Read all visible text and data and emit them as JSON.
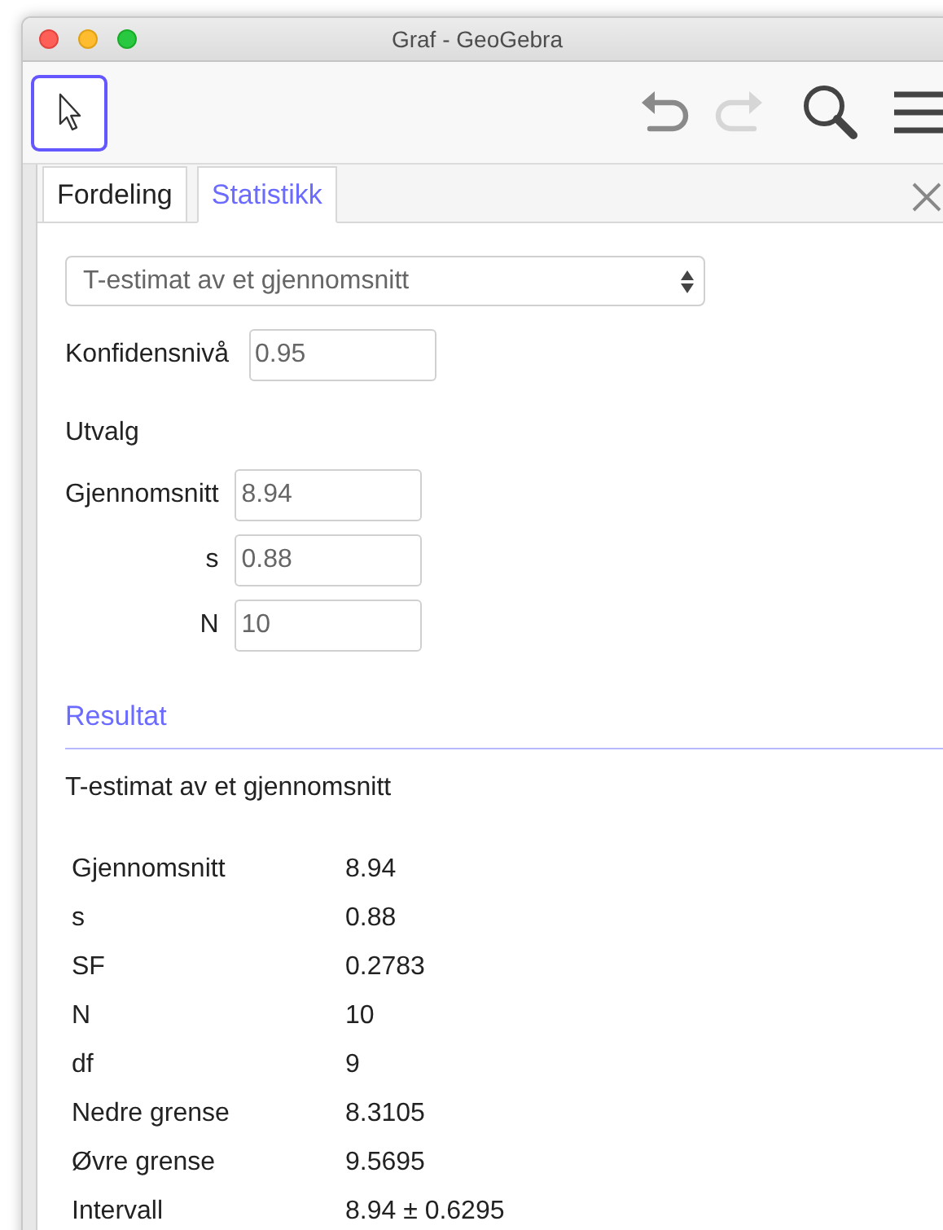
{
  "window": {
    "title": "Graf - GeoGebra"
  },
  "toolbar": {
    "move_tool": {
      "selected": true
    },
    "undo": {
      "disabled": false
    },
    "redo": {
      "disabled": true
    }
  },
  "tabs": [
    {
      "label": "Fordeling",
      "selected": false
    },
    {
      "label": "Statistikk",
      "selected": true
    }
  ],
  "procedure": {
    "value": "T-estimat av et gjennomsnitt"
  },
  "confidence": {
    "label": "Konfidensnivå",
    "value": "0.95"
  },
  "sample": {
    "heading": "Utvalg",
    "fields": [
      {
        "label": "Gjennomsnitt",
        "value": "8.94"
      },
      {
        "label": "s",
        "value": "0.88"
      },
      {
        "label": "N",
        "value": "10"
      }
    ]
  },
  "result": {
    "heading": "Resultat",
    "title": "T-estimat av et gjennomsnitt",
    "rows": [
      {
        "label": "Gjennomsnitt",
        "value": "8.94"
      },
      {
        "label": "s",
        "value": "0.88"
      },
      {
        "label": "SF",
        "value": "0.2783"
      },
      {
        "label": "N",
        "value": "10"
      },
      {
        "label": "df",
        "value": "9"
      },
      {
        "label": "Nedre grense",
        "value": "8.3105"
      },
      {
        "label": "Øvre grense",
        "value": "9.5695"
      },
      {
        "label": "Intervall",
        "value": "8.94 ± 0.6295"
      }
    ]
  }
}
